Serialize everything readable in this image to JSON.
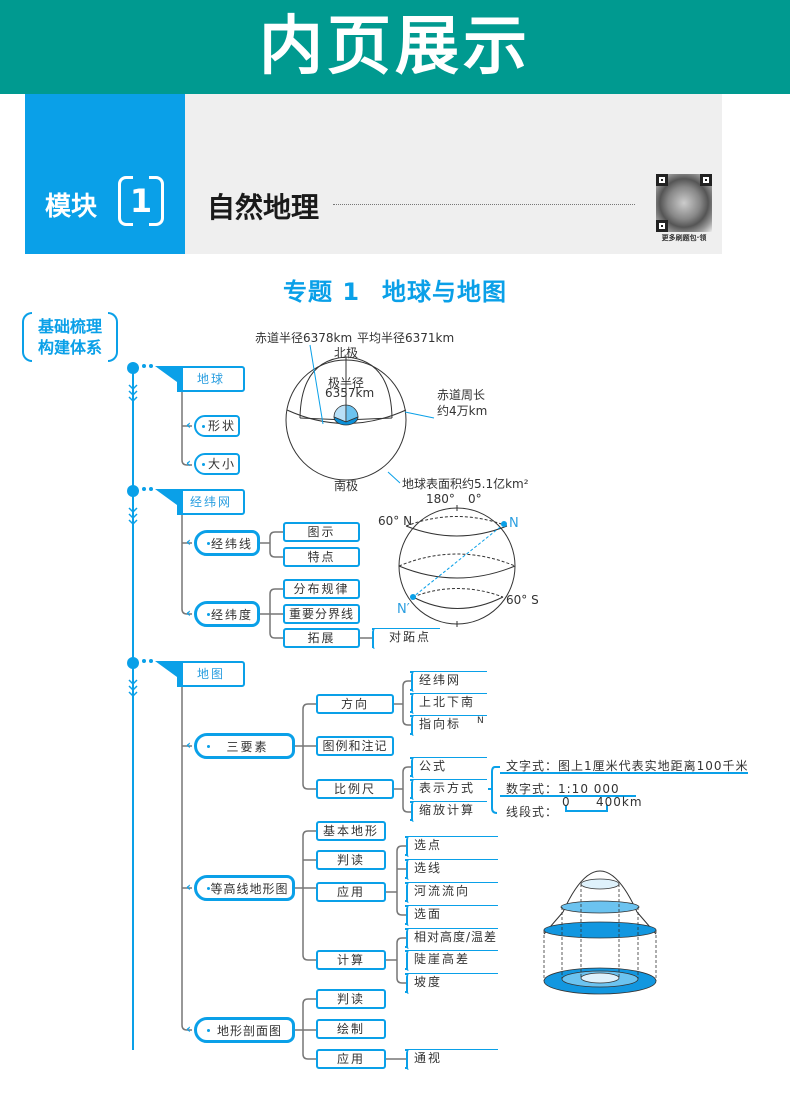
{
  "banner": {
    "title": "内页展示"
  },
  "module": {
    "label": "模块",
    "number": "1",
    "title": "自然地理",
    "qr_caption": "更多刷题包·领"
  },
  "topic": {
    "prefix": "专题 1",
    "title": "地球与地图"
  },
  "section_badge": {
    "line1": "基础梳理",
    "line2": "构建体系"
  },
  "colors": {
    "banner": "#009a90",
    "accent": "#0aa0e8",
    "panel": "#efefef",
    "line": "#666666"
  },
  "tree": {
    "earth": {
      "label": "地球",
      "children": [
        {
          "label": "形状"
        },
        {
          "label": "大小"
        }
      ]
    },
    "graticule": {
      "label": "经纬网",
      "lines": {
        "label": "经纬线",
        "children": [
          "图示",
          "特点"
        ]
      },
      "degrees": {
        "label": "经纬度",
        "children": [
          "分布规律",
          "重要分界线",
          "拓展"
        ],
        "extension_child": "对跖点"
      }
    },
    "map": {
      "label": "地图",
      "three_elements": {
        "label": "三要素",
        "direction": {
          "label": "方向",
          "children": [
            "经纬网",
            "上北下南",
            "指向标"
          ]
        },
        "legend": {
          "label": "图例和注记"
        },
        "scale": {
          "label": "比例尺",
          "children": [
            "公式",
            "表示方式",
            "缩放计算"
          ]
        }
      },
      "contour": {
        "label": "等高线地形图",
        "basic": "基本地形",
        "reading": "判读",
        "application": {
          "label": "应用",
          "children": [
            "选点",
            "选线",
            "河流流向",
            "选面"
          ]
        },
        "calculation": {
          "label": "计算",
          "children": [
            "相对高度/温差",
            "陡崖高差",
            "坡度"
          ]
        }
      },
      "profile": {
        "label": "地形剖面图",
        "children": [
          "判读",
          "绘制",
          "应用"
        ],
        "application_child": "通视"
      }
    }
  },
  "earth_diagram": {
    "equatorial_radius": "赤道半径6378km",
    "mean_radius": "平均半径6371km",
    "north_pole": "北极",
    "polar_radius_label": "极半径",
    "polar_radius_value": "6357km",
    "equator_circ_line1": "赤道周长",
    "equator_circ_line2": "约4万km",
    "south_pole": "南极",
    "surface_area": "地球表面积约5.1亿km²"
  },
  "globe_diagram": {
    "lon_180": "180°",
    "lon_0": "0°",
    "lat_60n": "60° N",
    "lat_60s": "60° S",
    "point_n": "N",
    "point_n_prime": "N′"
  },
  "scale_forms": {
    "text_form": "文字式：图上1厘米代表实地距离100千米",
    "numeric_form": "数字式：1:10 000",
    "line_form_label": "线段式：",
    "line_form_start": "0",
    "line_form_end": "400km"
  },
  "north_arrow": {
    "letter": "N"
  }
}
